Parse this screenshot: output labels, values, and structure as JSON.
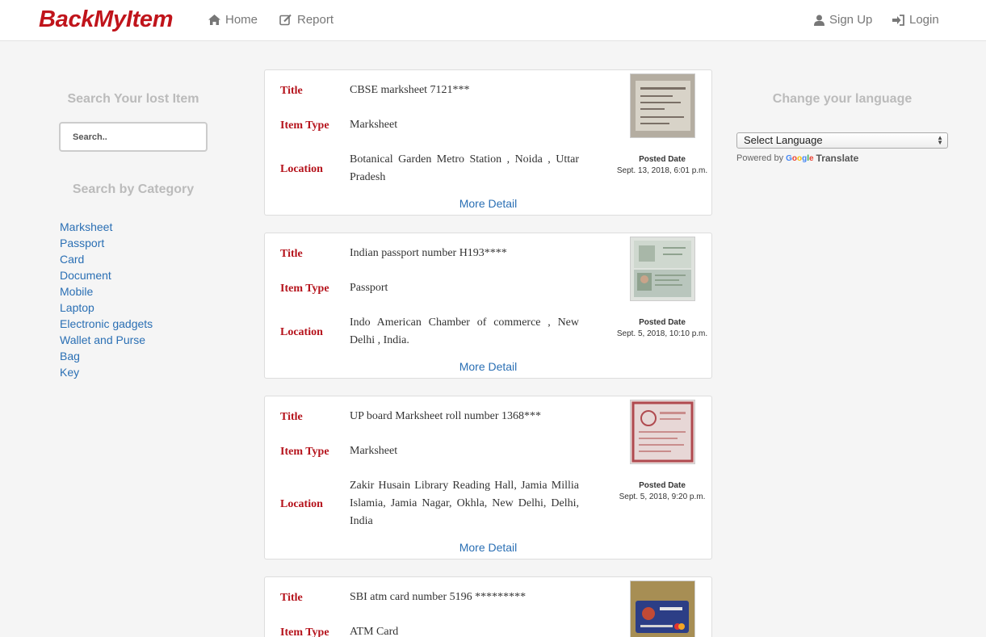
{
  "brand": "BackMyItem",
  "nav": {
    "home": "Home",
    "report": "Report",
    "signup": "Sign Up",
    "login": "Login"
  },
  "sidebar": {
    "search_title": "Search Your lost Item",
    "search_placeholder": "Search..",
    "category_title": "Search by Category",
    "categories": [
      "Marksheet",
      "Passport",
      "Card",
      "Document",
      "Mobile",
      "Laptop",
      "Electronic gadgets",
      "Wallet and Purse",
      "Bag",
      "Key"
    ]
  },
  "labels": {
    "title": "Title",
    "item_type": "Item Type",
    "location": "Location",
    "posted_date": "Posted Date",
    "more_detail": "More Detail"
  },
  "items": [
    {
      "title": "CBSE marksheet 7121***",
      "item_type": "Marksheet",
      "location": "Botanical Garden Metro Station , Noida , Uttar Pradesh",
      "posted": "Sept. 13, 2018, 6:01 p.m.",
      "thumb_colors": [
        "#b4ada1",
        "#d8d3c8",
        "#7a6f66"
      ]
    },
    {
      "title": "Indian passport number H193****",
      "item_type": "Passport",
      "location": "Indo American Chamber of commerce , New Delhi , India.",
      "posted": "Sept. 5, 2018, 10:10 p.m.",
      "thumb_colors": [
        "#dfe3de",
        "#b9c6bd",
        "#8fa28f"
      ]
    },
    {
      "title": "UP board Marksheet roll number 1368***",
      "item_type": "Marksheet",
      "location": "Zakir Husain Library Reading Hall, Jamia Millia Islamia, Jamia Nagar, Okhla, New Delhi, Delhi, India",
      "posted": "Sept. 5, 2018, 9:20 p.m.",
      "thumb_colors": [
        "#e7d7d6",
        "#c98d8c",
        "#b04a4f"
      ]
    },
    {
      "title": "SBI atm card number 5196 *********",
      "item_type": "ATM Card",
      "location": "",
      "posted": "",
      "thumb_colors": [
        "#a78e54",
        "#2c3e86",
        "#c24a35"
      ]
    }
  ],
  "language": {
    "title": "Change your language",
    "select_value": "Select Language",
    "powered_by": "Powered by",
    "google": "Google",
    "translate": "Translate"
  },
  "colors": {
    "brand": "#c0141b",
    "label": "#b5121b",
    "link": "#2a6fb4"
  }
}
